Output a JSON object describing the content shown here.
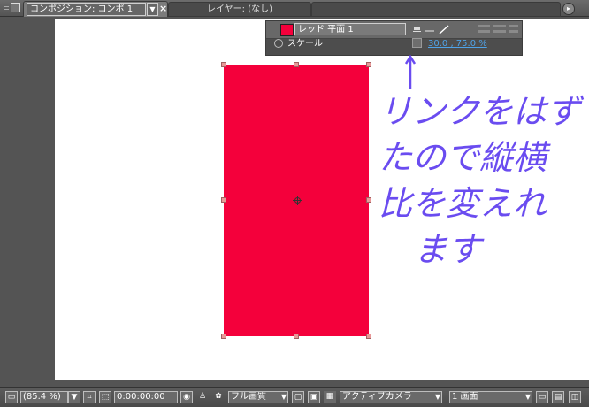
{
  "tabs": {
    "active_label": "コンポジション: コンポ 1",
    "inactive_label": "レイヤー: (なし)"
  },
  "layer_panel": {
    "layer_name": "レッド 平面 1",
    "property_name": "スケール",
    "property_value": "30.0 , 75.0 %",
    "layer_color": "#f4003b"
  },
  "annotation": {
    "lines": [
      "リンクをはずし",
      "たので縦横",
      "比を変えれ",
      "ます"
    ],
    "color": "#6a4cf0"
  },
  "toolbar": {
    "zoom": "(85.4 %)",
    "timecode": "0:00:00:00",
    "quality": "フル画質",
    "camera": "アクティブカメラ",
    "view_layout": "1 画面"
  },
  "icons": [
    "grip-icon",
    "comp-icon",
    "close-icon",
    "panel-menu-icon",
    "stopwatch-icon",
    "link-icon",
    "eye-icon",
    "pencil-icon",
    "snapshot-icon",
    "color-channels-icon",
    "grid-icon",
    "transparency-grid-icon",
    "region-of-interest-icon",
    "fast-previews-icon"
  ]
}
